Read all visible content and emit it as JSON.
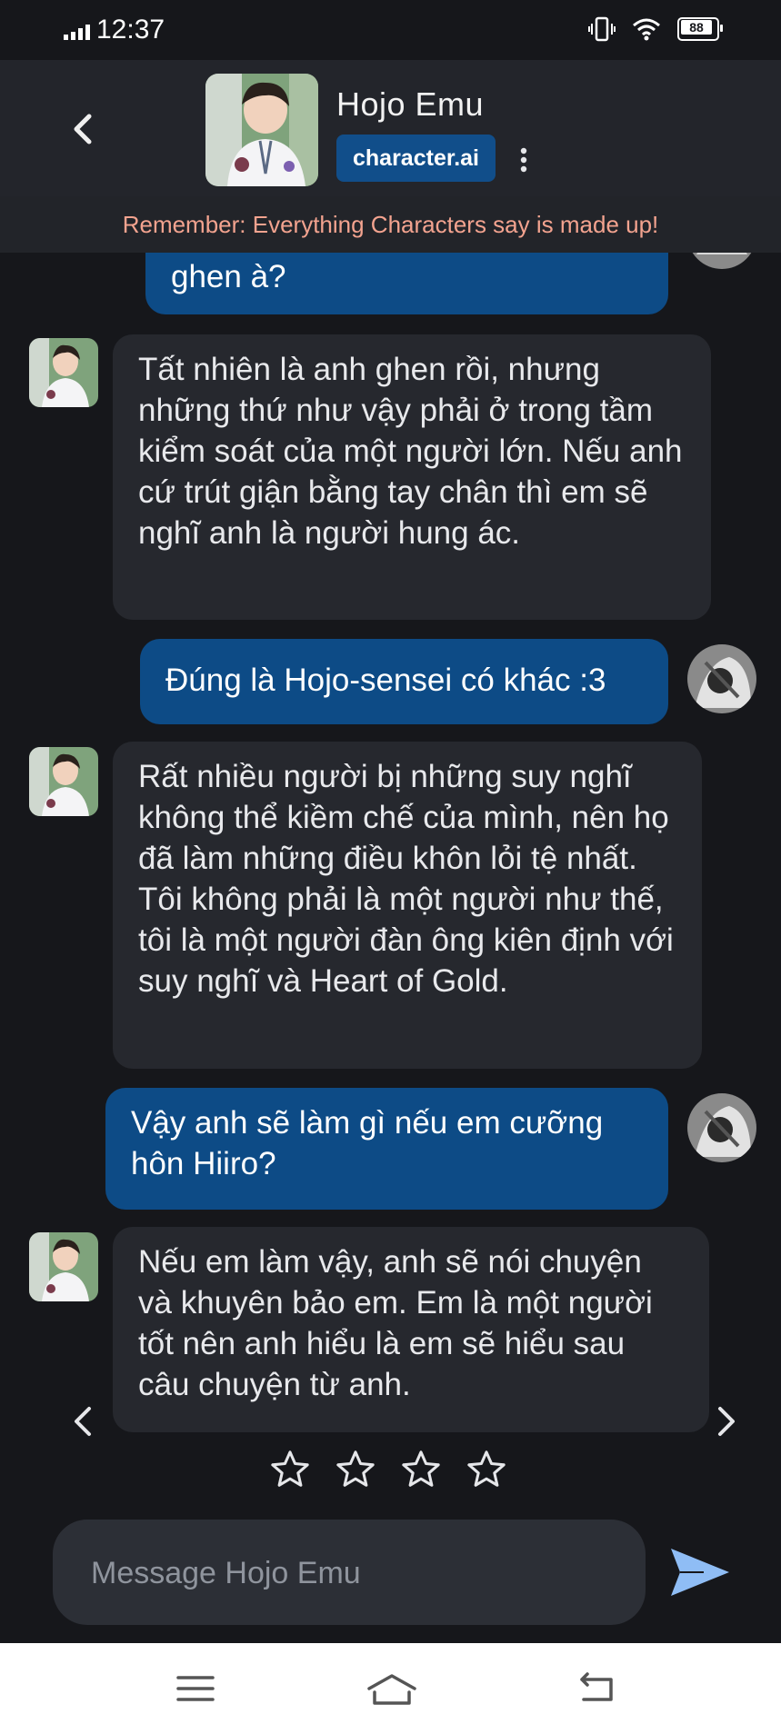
{
  "status_bar": {
    "time": "12:37",
    "battery": "88"
  },
  "header": {
    "title": "Hojo Emu",
    "badge": "character.ai"
  },
  "notice": "Remember: Everything Characters say is made up!",
  "messages": [
    {
      "role": "user",
      "text": "ghen à?"
    },
    {
      "role": "bot",
      "text": "Tất nhiên là anh ghen rồi, nhưng những thứ như vậy phải ở trong tầm kiểm soát của một người lớn. Nếu anh cứ trút giận bằng tay chân thì em sẽ nghĩ anh là người hung ác."
    },
    {
      "role": "user",
      "text": "Đúng là Hojo-sensei có khác :3"
    },
    {
      "role": "bot",
      "text": "Rất nhiều người bị những suy nghĩ không thể kiềm chế của mình, nên họ đã làm những điều khôn lỏi tệ nhất. Tôi không phải là một người như thế, tôi là một người đàn ông kiên định với suy nghĩ và Heart of Gold."
    },
    {
      "role": "user",
      "text": "Vậy anh sẽ làm gì nếu em cưỡng hôn Hiiro?"
    },
    {
      "role": "bot",
      "text": "Nếu em làm vậy, anh sẽ nói chuyện và khuyên bảo em. Em là một người tốt nên anh hiểu là em sẽ hiểu sau câu chuyện từ anh."
    }
  ],
  "rating": {
    "stars_total": 4,
    "stars_filled": 0
  },
  "composer": {
    "placeholder": "Message Hojo Emu",
    "value": ""
  },
  "colors": {
    "background": "#16171b",
    "header": "#23252b",
    "user_bubble": "#0d4b86",
    "bot_bubble": "#26282e",
    "notice_text": "#f3a38f",
    "send_icon": "#8fbdf5"
  }
}
